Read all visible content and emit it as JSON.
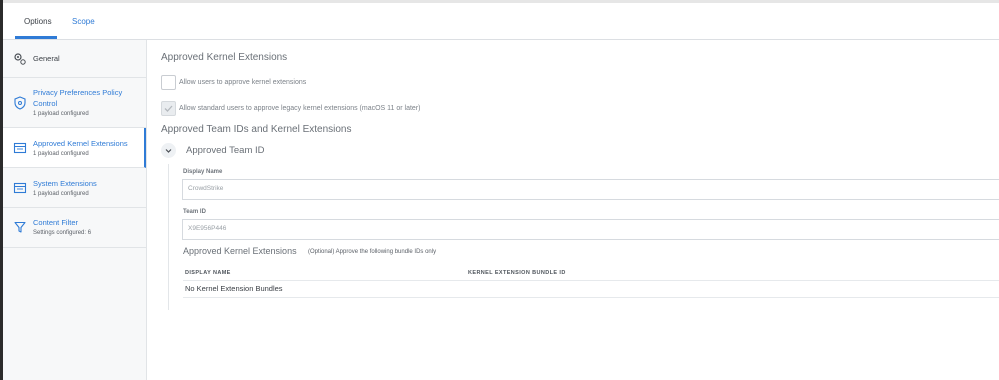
{
  "tabs": [
    {
      "label": "Options",
      "active": true
    },
    {
      "label": "Scope",
      "active": false
    }
  ],
  "sidebar": {
    "items": [
      {
        "title": "General",
        "subtitle": "",
        "icon": "gear-icon"
      },
      {
        "title": "Privacy Preferences Policy Control",
        "subtitle": "1 payload configured",
        "icon": "shield-icon"
      },
      {
        "title": "Approved Kernel Extensions",
        "subtitle": "1 payload configured",
        "icon": "kernel-extension-icon",
        "selected": true
      },
      {
        "title": "System Extensions",
        "subtitle": "1 payload configured",
        "icon": "system-extension-icon"
      },
      {
        "title": "Content Filter",
        "subtitle": "Settings configured: 6",
        "icon": "filter-icon"
      }
    ]
  },
  "main": {
    "title": "Approved Kernel Extensions",
    "checkboxes": [
      {
        "label": "Allow users to approve kernel extensions",
        "checked": false,
        "disabled": false
      },
      {
        "label": "Allow standard users to approve legacy kernel extensions (macOS 11 or later)",
        "checked": true,
        "disabled": true
      }
    ],
    "team_section_title": "Approved Team IDs and Kernel Extensions",
    "team": {
      "title": "Approved Team ID",
      "display_name_label": "Display Name",
      "display_name_value": "CrowdStrike",
      "team_id_label": "Team ID",
      "team_id_value": "X9E956P446"
    },
    "kernel_table": {
      "title": "Approved Kernel Extensions",
      "note": "(Optional) Approve the following bundle IDs only",
      "columns": [
        "DISPLAY NAME",
        "KERNEL EXTENSION BUNDLE ID"
      ],
      "empty_text": "No Kernel Extension Bundles"
    }
  },
  "colors": {
    "accent": "#2f7bd6",
    "sidebar_bg": "#f7f8f9",
    "border": "#dcdfe3"
  }
}
